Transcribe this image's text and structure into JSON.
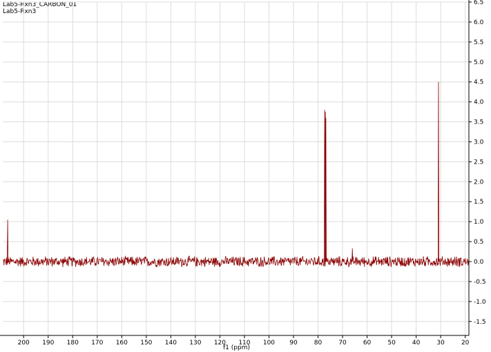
{
  "header": {
    "title": "Lab5-Rxn3_CARBON_01",
    "subtitle": "Lab5-Rxn3"
  },
  "chart_data": {
    "type": "line",
    "title": "Lab5-Rxn3_CARBON_01",
    "subtitle": "Lab5-Rxn3",
    "xlabel": "f1 (ppm)",
    "ylabel": "",
    "x_reversed": true,
    "xlim": [
      208.5,
      18.5
    ],
    "ylim": [
      -1.85,
      6.5
    ],
    "x_ticks": [
      200,
      190,
      180,
      170,
      160,
      150,
      140,
      130,
      120,
      110,
      100,
      90,
      80,
      70,
      60,
      50,
      40,
      30,
      20
    ],
    "x_tick_labels": [
      "200",
      "190",
      "180",
      "170",
      "160",
      "150",
      "140",
      "130",
      "120",
      "110",
      "100",
      "90",
      "80",
      "70",
      "60",
      "50",
      "40",
      "30",
      "20"
    ],
    "y_ticks": [
      6.5,
      6.0,
      5.5,
      5.0,
      4.5,
      4.0,
      3.5,
      3.0,
      2.5,
      2.0,
      1.5,
      1.0,
      0.5,
      0.0,
      -0.5,
      -1.0,
      -1.5
    ],
    "y_tick_labels": [
      "6.5",
      "6.0",
      "5.5",
      "5.0",
      "4.5",
      "4.0",
      "3.5",
      "3.0",
      "2.5",
      "2.0",
      "1.5",
      "1.0",
      "0.5",
      "0.0",
      "-0.5",
      "-1.0",
      "-1.5"
    ],
    "grid": true,
    "baseline_noise_amplitude": 0.15,
    "series": [
      {
        "color": "#8b0000",
        "peaks": [
          {
            "ppm": 206.5,
            "intensity": 1.05
          },
          {
            "ppm": 77.3,
            "intensity": 3.8
          },
          {
            "ppm": 77.0,
            "intensity": 3.75
          },
          {
            "ppm": 76.8,
            "intensity": 3.6
          },
          {
            "ppm": 66.0,
            "intensity": 0.33
          },
          {
            "ppm": 30.9,
            "intensity": 4.5
          }
        ]
      }
    ]
  }
}
